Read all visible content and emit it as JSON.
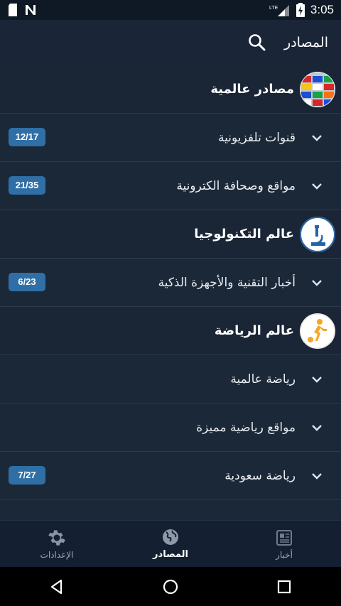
{
  "status_bar": {
    "time": "3:05",
    "network": "LTE"
  },
  "app_bar": {
    "title": "المصادر"
  },
  "groups": [
    {
      "title": "مصادر عالمية",
      "icon": "world-flags-globe-icon",
      "items": [
        {
          "label": "قنوات تلفزيونية",
          "badge": "12/17"
        },
        {
          "label": "مواقع وصحافة الكترونية",
          "badge": "21/35"
        }
      ]
    },
    {
      "title": "عالم التكنولوجيا",
      "icon": "microscope-icon",
      "items": [
        {
          "label": "أخبار التقنية والأجهزة الذكية",
          "badge": "6/23"
        }
      ]
    },
    {
      "title": "عالم الرياضة",
      "icon": "soccer-player-icon",
      "items": [
        {
          "label": "رياضة عالمية",
          "badge": ""
        },
        {
          "label": "مواقع رياضية مميزة",
          "badge": ""
        },
        {
          "label": "رياضة سعودية",
          "badge": "7/27"
        }
      ]
    }
  ],
  "bottom_nav": {
    "settings": "الإعدادات",
    "sources": "المصادر",
    "news": "أخبار"
  },
  "colors": {
    "background": "#1b2838",
    "badge": "#2f6fa6",
    "accent_orange": "#f5a623"
  }
}
